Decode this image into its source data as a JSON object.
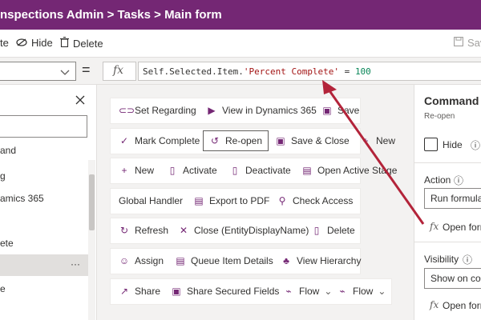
{
  "titlebar": {
    "breadcrumb": "nspections Admin > Tasks > Main form"
  },
  "commandbar": {
    "edit_label": "te",
    "hide_label": "Hide",
    "delete_label": "Delete",
    "save_label": "Sav"
  },
  "formulabar": {
    "equals": "=",
    "fx": "fx",
    "formula_prefix": "Self.Selected.Item.",
    "formula_string": "'Percent Complete'",
    "formula_operator": " = ",
    "formula_value": "100"
  },
  "tree": {
    "items": [
      "and",
      "g",
      "amics 365",
      "ete",
      "",
      "e"
    ],
    "more": "···"
  },
  "canvas": {
    "rows": [
      [
        {
          "label": "Set Regarding",
          "icon": "link-icon"
        },
        {
          "label": "View in Dynamics 365",
          "icon": "dynamics-icon"
        },
        {
          "label": "Save",
          "icon": "save-icon"
        }
      ],
      [
        {
          "label": "Mark Complete",
          "icon": "check-icon"
        },
        {
          "label": "Re-open",
          "icon": "history-icon"
        },
        {
          "label": "Save & Close",
          "icon": "save-close-icon"
        },
        {
          "label": "New",
          "icon": "plus-icon"
        }
      ],
      [
        {
          "label": "New",
          "icon": "plus-icon"
        },
        {
          "label": "Activate",
          "icon": "document-icon"
        },
        {
          "label": "Deactivate",
          "icon": "document-icon"
        },
        {
          "label": "Open Active Stage",
          "icon": "stage-icon"
        }
      ],
      [
        {
          "label": "Global Handler",
          "icon": ""
        },
        {
          "label": "Export to PDF",
          "icon": "pdf-icon"
        },
        {
          "label": "Check Access",
          "icon": "search-icon"
        }
      ],
      [
        {
          "label": "Refresh",
          "icon": "refresh-icon"
        },
        {
          "label": "Close (EntityDisplayName)",
          "icon": "close-icon"
        },
        {
          "label": "Delete",
          "icon": "trash-icon"
        }
      ],
      [
        {
          "label": "Assign",
          "icon": "person-icon"
        },
        {
          "label": "Queue Item Details",
          "icon": "queue-icon"
        },
        {
          "label": "View Hierarchy",
          "icon": "hierarchy-icon"
        }
      ],
      [
        {
          "label": "Share",
          "icon": "share-icon"
        },
        {
          "label": "Share Secured Fields",
          "icon": "share-fields-icon"
        },
        {
          "label": "Flow",
          "icon": "flow-icon"
        },
        {
          "label": "Flow",
          "icon": "flow-icon"
        }
      ]
    ]
  },
  "rightpanel": {
    "title": "Command",
    "subtitle": "Re-open",
    "hide_label": "Hide",
    "action_label": "Action",
    "action_value": "Run formula",
    "open_formula_1": "Open form",
    "visibility_label": "Visibility",
    "visibility_value": "Show on con",
    "open_formula_2": "Open form"
  },
  "colors": {
    "brand": "#742774",
    "arrow": "#b3243a"
  }
}
